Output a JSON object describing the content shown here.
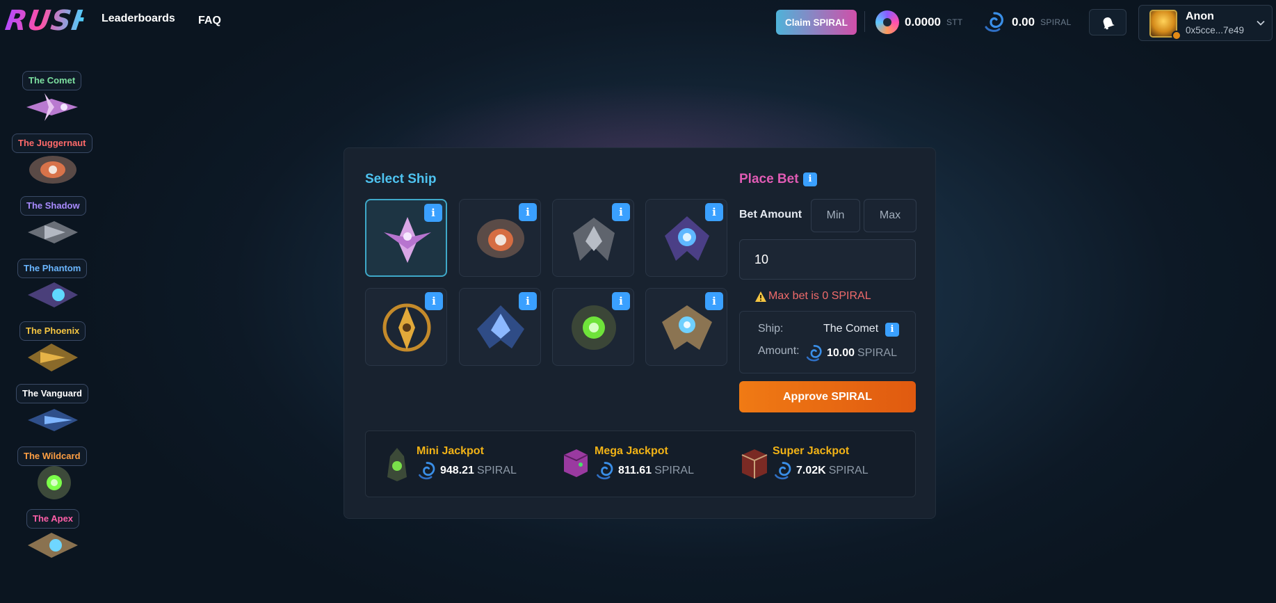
{
  "header": {
    "logo": "RUSH",
    "nav": [
      "Leaderboards",
      "FAQ"
    ],
    "claim_label": "Claim SPIRAL",
    "stt_balance": "0.0000",
    "stt_unit": "STT",
    "spiral_balance": "0.00",
    "spiral_unit": "SPIRAL",
    "user_name": "Anon",
    "user_address": "0x5cce...7e49"
  },
  "sidebar": {
    "ships": [
      {
        "name": "The Comet",
        "color": "#7de0a0"
      },
      {
        "name": "The Juggernaut",
        "color": "#ff6a6a"
      },
      {
        "name": "The Shadow",
        "color": "#a98bff"
      },
      {
        "name": "The Phantom",
        "color": "#6ab6ff"
      },
      {
        "name": "The Phoenix",
        "color": "#f5c542"
      },
      {
        "name": "The Vanguard",
        "color": "#ffffff"
      },
      {
        "name": "The Wildcard",
        "color": "#ff9f43"
      },
      {
        "name": "The Apex",
        "color": "#ff5fa8"
      }
    ]
  },
  "main": {
    "select_title": "Select Ship",
    "bet_title": "Place Bet",
    "info_glyph": "i",
    "bet_amount_label": "Bet Amount",
    "min_label": "Min",
    "max_label": "Max",
    "bet_value": "10",
    "warning": "Max bet is 0 SPIRAL",
    "summary": {
      "ship_key": "Ship:",
      "ship_value": "The Comet",
      "amount_key": "Amount:",
      "amount_value": "10.00",
      "amount_unit": "SPIRAL"
    },
    "approve_label": "Approve SPIRAL",
    "jackpots": [
      {
        "name": "Mini Jackpot",
        "value": "948.21",
        "unit": "SPIRAL"
      },
      {
        "name": "Mega Jackpot",
        "value": "811.61",
        "unit": "SPIRAL"
      },
      {
        "name": "Super Jackpot",
        "value": "7.02K",
        "unit": "SPIRAL"
      }
    ]
  },
  "colors": {
    "accent_cyan": "#4ec3f0",
    "accent_pink": "#e05bb4",
    "approve_orange": "#f07a14",
    "jackpot_gold": "#f2b316",
    "warning_red": "#f06b6b"
  }
}
